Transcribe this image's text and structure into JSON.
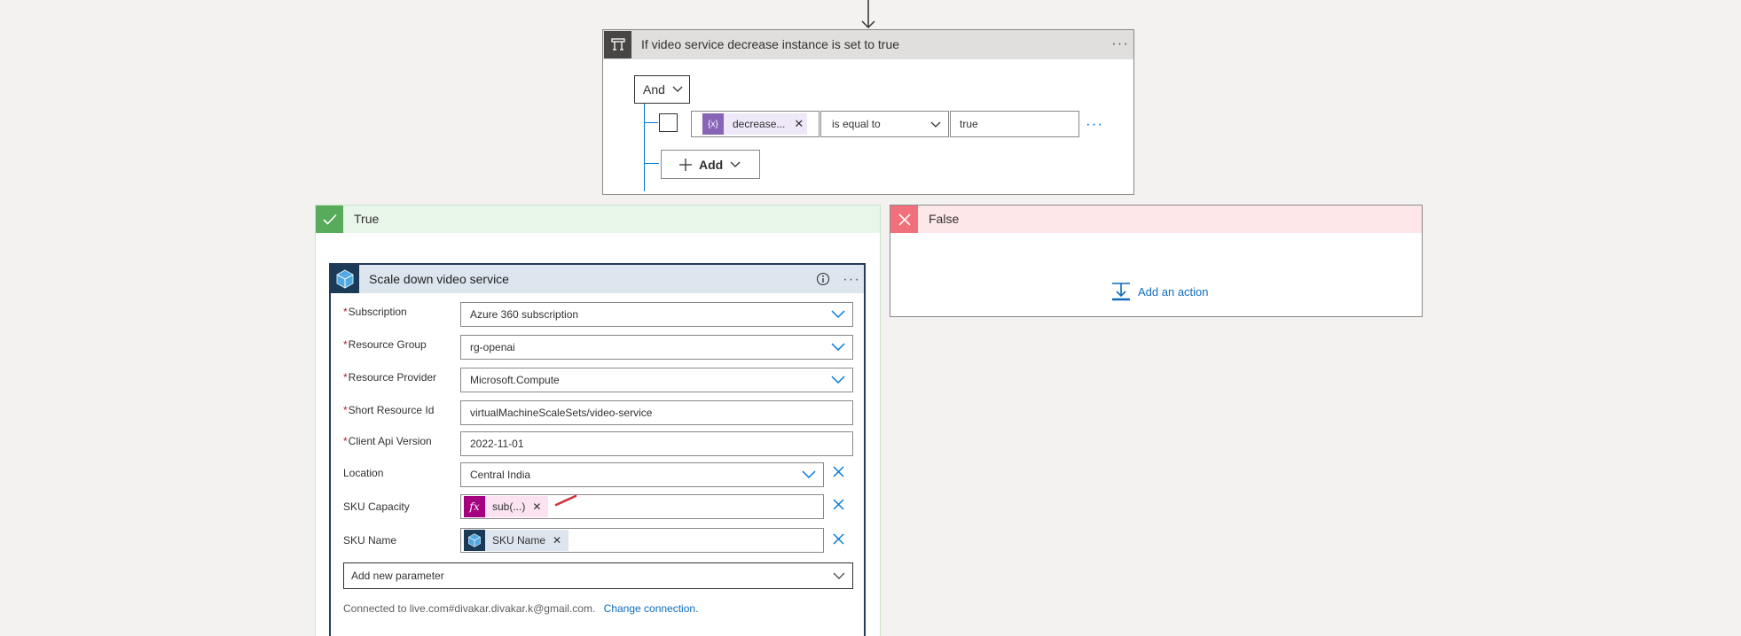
{
  "condition": {
    "title": "If video service decrease instance is set to true",
    "and_label": "And",
    "rows": [
      {
        "left_token": "decrease...",
        "operator": "is equal to",
        "value": "true"
      }
    ],
    "add_label": "Add"
  },
  "branches": {
    "true_label": "True",
    "false_label": "False",
    "add_action_label": "Add an action"
  },
  "action": {
    "title": "Scale down video service",
    "params": {
      "subscription": {
        "label": "Subscription",
        "value": "Azure 360 subscription"
      },
      "resource_group": {
        "label": "Resource Group",
        "value": "rg-openai"
      },
      "resource_provider": {
        "label": "Resource Provider",
        "value": "Microsoft.Compute"
      },
      "short_resource_id": {
        "label": "Short Resource Id",
        "value": "virtualMachineScaleSets/video-service"
      },
      "client_api_version": {
        "label": "Client Api Version",
        "value": "2022-11-01"
      },
      "location": {
        "label": "Location",
        "value": "Central India"
      },
      "sku_capacity": {
        "label": "SKU Capacity",
        "token": "sub(...)",
        "token_icon": "fx"
      },
      "sku_name": {
        "label": "SKU Name",
        "token": "SKU Name"
      }
    },
    "add_param_placeholder": "Add new parameter",
    "connected_text": "Connected to live.com#divakar.divakar.k@gmail.com.",
    "change_connection": "Change connection."
  },
  "colors": {
    "accent": "#0078d4",
    "true_green": "#57ab5a",
    "false_red": "#f1707b",
    "expression_purple": "#8764b8",
    "function_magenta": "#a4007f",
    "required_red": "#a4262c"
  },
  "icons": [
    "down-arrow-icon",
    "condition-icon",
    "more-icon",
    "chevron-down-icon",
    "variable-icon",
    "close-icon",
    "plus-icon",
    "check-icon",
    "cross-icon",
    "add-action-icon",
    "azure-resource-icon",
    "info-icon",
    "function-icon",
    "clear-icon"
  ]
}
